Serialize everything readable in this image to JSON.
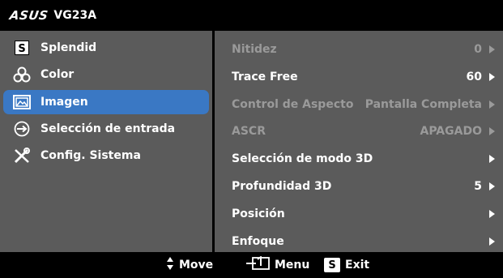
{
  "header": {
    "brand": "ASUS",
    "model": "VG23A"
  },
  "nav": [
    {
      "label": "Splendid",
      "icon": "splendid-s-icon",
      "selected": false
    },
    {
      "label": "Color",
      "icon": "color-circles-icon",
      "selected": false
    },
    {
      "label": "Imagen",
      "icon": "image-icon",
      "selected": true
    },
    {
      "label": "Selección de entrada",
      "icon": "input-arrow-icon",
      "selected": false
    },
    {
      "label": "Config. Sistema",
      "icon": "tools-icon",
      "selected": false
    }
  ],
  "settings": [
    {
      "label": "Nitidez",
      "value": "0",
      "enabled": false
    },
    {
      "label": "Trace Free",
      "value": "60",
      "enabled": true
    },
    {
      "label": "Control de Aspecto",
      "value": "Pantalla Completa",
      "enabled": false
    },
    {
      "label": "ASCR",
      "value": "APAGADO",
      "enabled": false
    },
    {
      "label": "Selección de modo 3D",
      "value": "",
      "enabled": true
    },
    {
      "label": "Profundidad 3D",
      "value": "5",
      "enabled": true
    },
    {
      "label": "Posición",
      "value": "",
      "enabled": true
    },
    {
      "label": "Enfoque",
      "value": "",
      "enabled": true
    }
  ],
  "footer": {
    "move": "Move",
    "menu": "Menu",
    "exit_key": "S",
    "exit": "Exit"
  },
  "colors": {
    "panel": "#5b5b5b",
    "selected": "#3a78c4",
    "disabled_text": "#9a9a9a"
  }
}
